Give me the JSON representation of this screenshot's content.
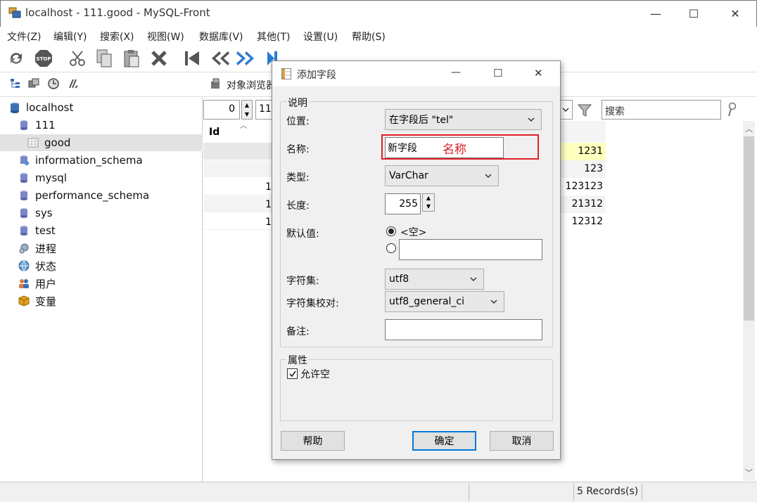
{
  "window": {
    "title": "localhost - 111.good - MySQL-Front",
    "minimize": "—",
    "maximize": "☐",
    "close": "✕"
  },
  "menu": [
    "文件(Z)",
    "编辑(Y)",
    "搜索(X)",
    "视图(W)",
    "数据库(V)",
    "其他(T)",
    "设置(U)",
    "帮助(S)"
  ],
  "toolbar2": {
    "object_browser": "对象浏览器"
  },
  "tree": {
    "items": [
      {
        "label": "localhost",
        "icon": "server-icon"
      },
      {
        "label": "111",
        "icon": "database-icon"
      },
      {
        "label": "good",
        "icon": "table-icon",
        "selected": true
      },
      {
        "label": "information_schema",
        "icon": "database-system-icon"
      },
      {
        "label": "mysql",
        "icon": "database-icon"
      },
      {
        "label": "performance_schema",
        "icon": "database-icon"
      },
      {
        "label": "sys",
        "icon": "database-icon"
      },
      {
        "label": "test",
        "icon": "database-icon"
      },
      {
        "label": "进程",
        "icon": "process-icon"
      },
      {
        "label": "状态",
        "icon": "status-icon"
      },
      {
        "label": "用户",
        "icon": "users-icon"
      },
      {
        "label": "变量",
        "icon": "variables-icon"
      }
    ]
  },
  "grid": {
    "offset_value": "0",
    "limit_partial": "11",
    "search_placeholder": "搜索",
    "column_id": "Id",
    "partial_rows": [
      "1",
      "1",
      "1"
    ],
    "right_values": [
      "1231",
      "123",
      "123123",
      "21312",
      "12312"
    ]
  },
  "status": {
    "records": "5 Records(s)"
  },
  "dialog": {
    "title": "添加字段",
    "minimize": "—",
    "maximize": "☐",
    "close": "✕",
    "group_description": "说明",
    "position_label": "位置:",
    "position_value": "在字段后 \"tel\"",
    "name_label": "名称:",
    "name_value": "新字段",
    "name_annotation": "名称",
    "type_label": "类型:",
    "type_value": "VarChar",
    "length_label": "长度:",
    "length_value": "255",
    "default_label": "默认值:",
    "default_empty": "<空>",
    "default_custom_value": "",
    "charset_label": "字符集:",
    "charset_value": "utf8",
    "collation_label": "字符集校对:",
    "collation_value": "utf8_general_ci",
    "comment_label": "备注:",
    "comment_value": "",
    "group_attributes": "属性",
    "allow_null_label": "允许空",
    "allow_null_checked": true,
    "help_button": "帮助",
    "ok_button": "确定",
    "cancel_button": "取消"
  },
  "colors": {
    "annotation_red": "#e0202a",
    "highlight_yellow": "#ffffc0",
    "default_button_border": "#0078d7"
  }
}
